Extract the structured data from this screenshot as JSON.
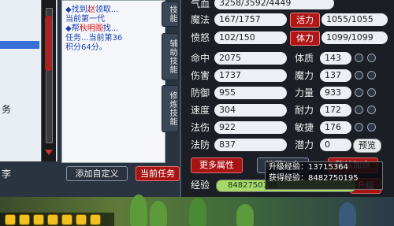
{
  "quest": {
    "lines": [
      {
        "pre": "◆找到",
        "red": "赵",
        "post": "领取..."
      },
      {
        "pre": "  当前第",
        "red": "",
        "post": "一代"
      },
      {
        "pre": "◆帮",
        "red": "秋明阁",
        "post": "找..."
      },
      {
        "pre": "  任务...当前第36",
        "red": "",
        "post": ""
      },
      {
        "pre": "  积分64分。",
        "red": "",
        "post": ""
      }
    ]
  },
  "left_panel": {
    "side_text": "务",
    "bottom_text": "李"
  },
  "tabs": [
    "技能",
    "辅助技能",
    "修炼技能"
  ],
  "stats": {
    "hp_label": "气血",
    "hp_value": "3258/3592/4449",
    "mp_label": "魔法",
    "mp_value": "167/1757",
    "vitality_label": "活力",
    "vitality_value": "1055/1055",
    "rage_label": "愤怒",
    "rage_value": "102/150",
    "stamina_label": "体力",
    "stamina_value": "1099/1099",
    "left": [
      {
        "label": "命中",
        "value": "2075"
      },
      {
        "label": "伤害",
        "value": "1737"
      },
      {
        "label": "防御",
        "value": "955"
      },
      {
        "label": "速度",
        "value": "304"
      },
      {
        "label": "法伤",
        "value": "922"
      },
      {
        "label": "法防",
        "value": "837"
      }
    ],
    "right": [
      {
        "label": "体质",
        "value": "143"
      },
      {
        "label": "魔力",
        "value": "137"
      },
      {
        "label": "力量",
        "value": "933"
      },
      {
        "label": "耐力",
        "value": "172"
      },
      {
        "label": "敏捷",
        "value": "176"
      },
      {
        "label": "潜力",
        "value": "0"
      }
    ],
    "preview_button": "预览",
    "more_attributes_button": "更多属性",
    "recommend_button": "推荐加点",
    "confirm_button": "确认加点",
    "exp_label": "经验",
    "exp_value": "8482750195",
    "upgrade_button": "升级"
  },
  "tooltip": {
    "line1": "升级经验：13715364",
    "line2": "获得经验：8482750195"
  },
  "buttons": {
    "add_custom": "添加自定义",
    "back_task": "当前任务"
  },
  "colors": {
    "accent_red": "#b01818",
    "panel_bg": "#1b1e24"
  }
}
